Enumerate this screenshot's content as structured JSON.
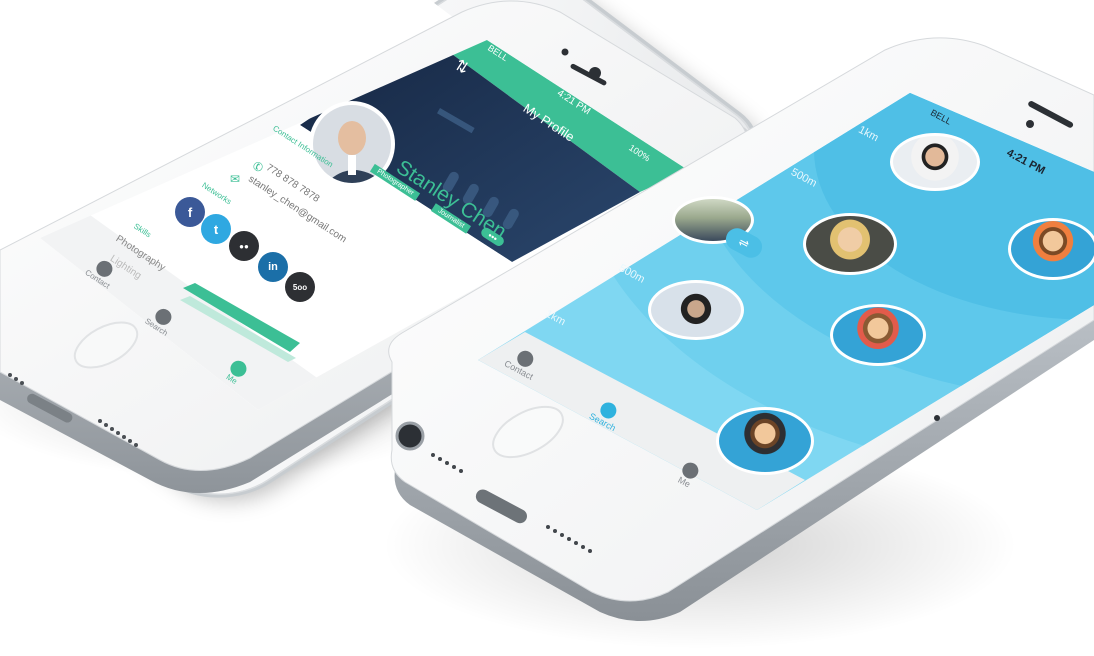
{
  "left_phone": {
    "status": {
      "carrier": "BELL",
      "time": "4:21 PM",
      "battery": "100%"
    },
    "nav": {
      "title": "My Profile",
      "icon": "sync-arrows-icon"
    },
    "profile": {
      "name": "Stanley Chen",
      "tags": [
        "Photographer",
        "Journalist"
      ],
      "more": "•••"
    },
    "contact": {
      "heading": "Contact Information",
      "phone": "778 878 7878",
      "email": "stanley_chen@gmail.com"
    },
    "networks": {
      "heading": "Networks",
      "items": [
        {
          "icon": "facebook-icon",
          "glyph": "f",
          "color": "#3b5998"
        },
        {
          "icon": "twitter-icon",
          "glyph": "t",
          "color": "#2fa8e1"
        },
        {
          "icon": "flickr-icon",
          "glyph": "●●",
          "color": "#2d2f33"
        },
        {
          "icon": "linkedin-icon",
          "glyph": "in",
          "color": "#1b6fa8"
        },
        {
          "icon": "500px-icon",
          "glyph": "5oo",
          "color": "#2d2f33"
        }
      ]
    },
    "skills": {
      "heading": "Skills",
      "items": [
        "Photography",
        "Lighting"
      ]
    },
    "tabs": [
      {
        "label": "Contact",
        "icon": "contact-icon",
        "active": false
      },
      {
        "label": "Search",
        "icon": "search-icon",
        "active": false
      },
      {
        "label": "Me",
        "icon": "me-icon",
        "active": true
      }
    ],
    "colors": {
      "accent": "#3cbf95"
    }
  },
  "right_phone": {
    "status": {
      "carrier": "BELL",
      "time": "4:21 PM"
    },
    "distances": [
      "1km",
      "500m",
      "500m",
      "1km"
    ],
    "tabs": [
      {
        "label": "Contact",
        "icon": "contact-icon",
        "active": false
      },
      {
        "label": "Search",
        "icon": "search-icon",
        "active": true
      },
      {
        "label": "Me",
        "icon": "me-icon",
        "active": false
      }
    ],
    "filter_icon": "filter-sliders-icon",
    "colors": {
      "accent": "#2fb2de",
      "background": "#7fd7f2"
    }
  }
}
